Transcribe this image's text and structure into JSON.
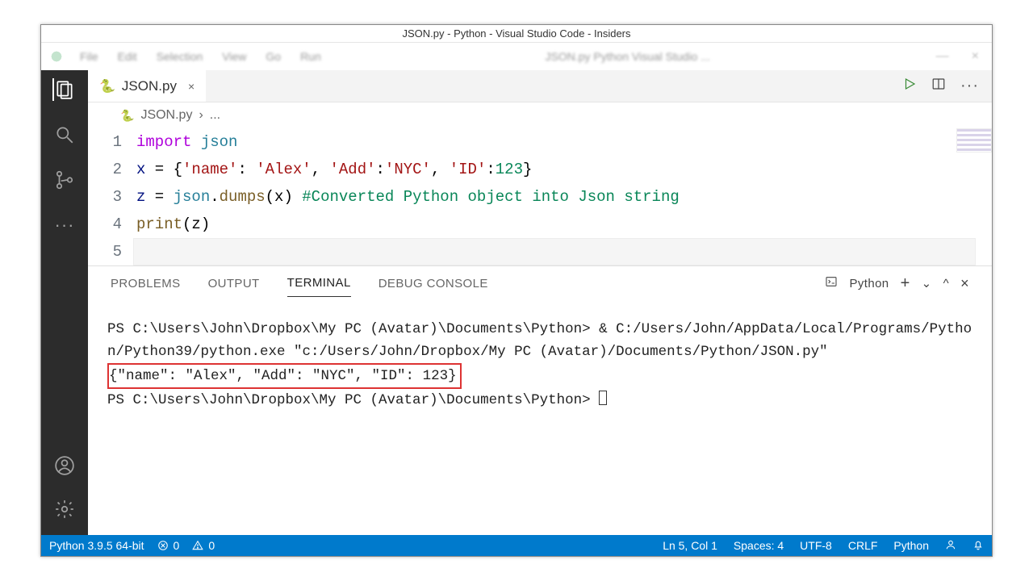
{
  "window": {
    "title": "JSON.py - Python - Visual Studio Code - Insiders"
  },
  "menubar": {
    "items": [
      "File",
      "Edit",
      "Selection",
      "View",
      "Go",
      "Run"
    ],
    "right_blur": "JSON.py  Python  Visual Studio ..."
  },
  "tab": {
    "filename": "JSON.py",
    "close": "×"
  },
  "breadcrumb": {
    "file": "JSON.py",
    "sep": "›",
    "rest": "..."
  },
  "code": {
    "line_numbers": [
      "1",
      "2",
      "3",
      "4",
      "5"
    ],
    "l1": {
      "kw": "import",
      "mod": "json"
    },
    "l2": {
      "var": "x",
      "eq": " = ",
      "body_open": "{",
      "k1": "'name'",
      "c1": ": ",
      "v1": "'Alex'",
      "s1": ", ",
      "k2": "'Add'",
      "c2": ":",
      "v2": "'NYC'",
      "s2": ", ",
      "k3": "'ID'",
      "c3": ":",
      "v3": "123",
      "body_close": "}"
    },
    "l3": {
      "var": "z",
      "eq": " = ",
      "mod": "json",
      "dot": ".",
      "fn": "dumps",
      "args": "(x)",
      "sp": " ",
      "comment": "#Converted Python object into Json string"
    },
    "l4": {
      "fn": "print",
      "args": "(z)"
    }
  },
  "panel": {
    "tabs": {
      "problems": "PROBLEMS",
      "output": "OUTPUT",
      "terminal": "TERMINAL",
      "debug": "DEBUG CONSOLE"
    },
    "right_label": "Python",
    "plus": "+",
    "collapse": "⌄",
    "caret": "^",
    "close": "×"
  },
  "terminal": {
    "line1": "PS C:\\Users\\John\\Dropbox\\My PC (Avatar)\\Documents\\Python> & C:/Users/John/AppData/Local/Programs/Python/Python39/python.exe \"c:/Users/John/Dropbox/My PC (Avatar)/Documents/Python/JSON.py\"",
    "output": "{\"name\": \"Alex\", \"Add\": \"NYC\", \"ID\": 123}",
    "prompt2": "PS C:\\Users\\John\\Dropbox\\My PC (Avatar)\\Documents\\Python> "
  },
  "status": {
    "python_ver": "Python 3.9.5 64-bit",
    "errors": "0",
    "warnings": "0",
    "ln_col": "Ln 5, Col 1",
    "spaces": "Spaces: 4",
    "encoding": "UTF-8",
    "eol": "CRLF",
    "lang": "Python"
  }
}
